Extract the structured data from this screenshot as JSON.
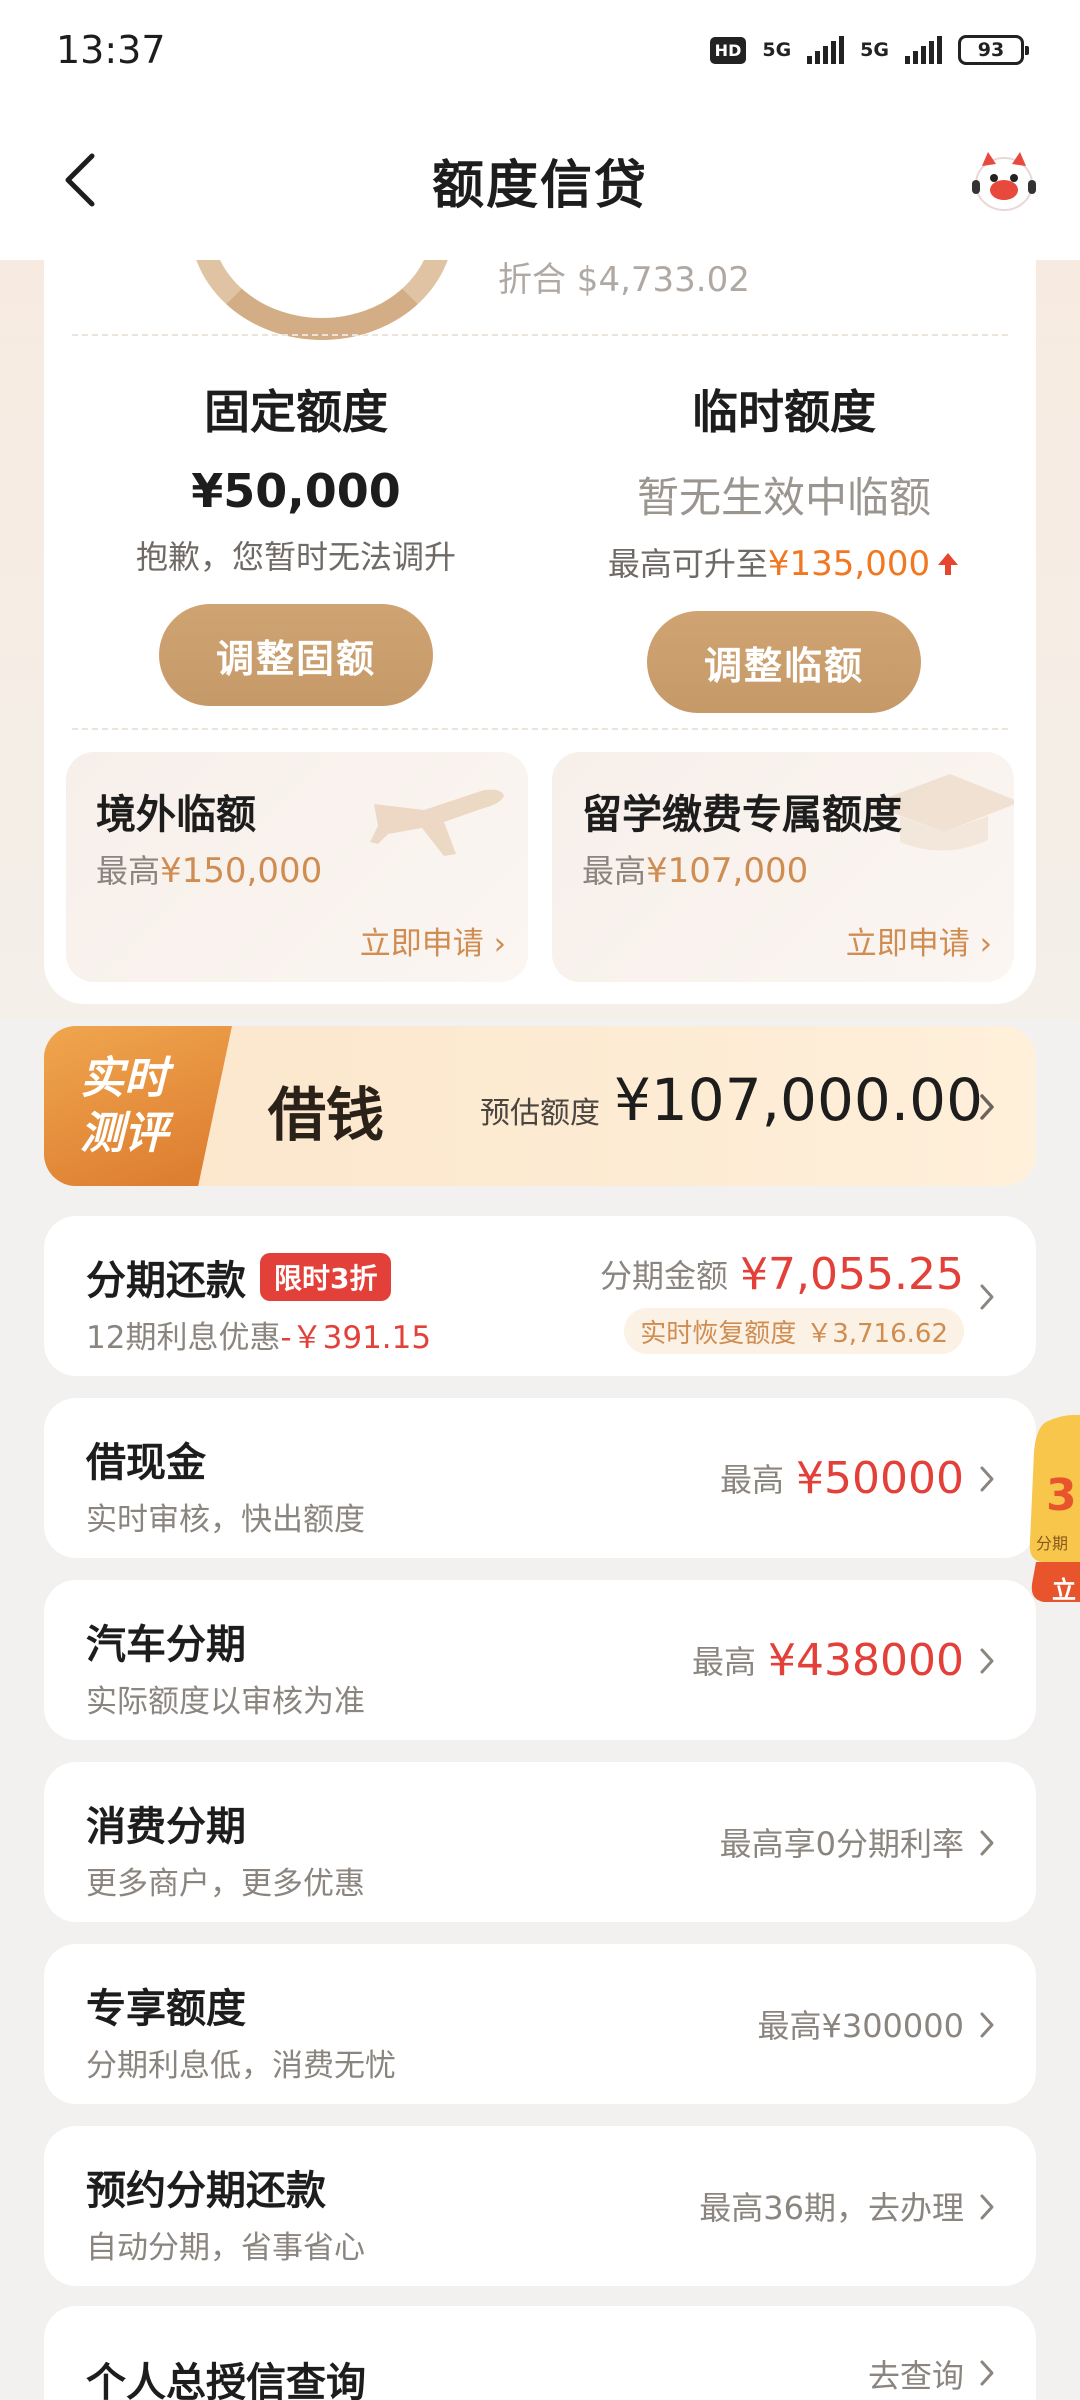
{
  "status": {
    "time": "13:37",
    "network1": "5G",
    "network2": "5G",
    "hd": "HD",
    "battery": "93"
  },
  "nav": {
    "title": "额度信贷"
  },
  "summary": {
    "converted": "折合 $4,733.02"
  },
  "fixed_limit": {
    "title": "固定额度",
    "amount": "¥50,000",
    "note": "抱歉，您暂时无法调升",
    "button": "调整固额"
  },
  "temp_limit": {
    "title": "临时额度",
    "status": "暂无生效中临额",
    "note_prefix": "最高可升至",
    "note_amount": "¥135,000",
    "button": "调整临额"
  },
  "promos": [
    {
      "title": "境外临额",
      "prefix": "最高",
      "amount": "¥150,000",
      "link": "立即申请"
    },
    {
      "title": "留学缴费专属额度",
      "prefix": "最高",
      "amount": "¥107,000",
      "link": "立即申请"
    }
  ],
  "borrow": {
    "tag_line1": "实时",
    "tag_line2": "测评",
    "title": "借钱",
    "est_label": "预估额度",
    "est_amount": "¥107,000.00"
  },
  "installment": {
    "title": "分期还款",
    "tag": "限时3折",
    "sub_prefix": "12期利息优惠",
    "sub_amount": "-￥391.15",
    "amount_label": "分期金额",
    "amount": "¥7,055.25",
    "recover_label": "实时恢复额度",
    "recover_amount": "￥3,716.62"
  },
  "list": [
    {
      "title": "借现金",
      "sub": "实时审核，快出额度",
      "right_label": "最高",
      "right_value": "¥50000"
    },
    {
      "title": "汽车分期",
      "sub": "实际额度以审核为准",
      "right_label": "最高",
      "right_value": "¥438000"
    },
    {
      "title": "消费分期",
      "sub": "更多商户，更多优惠",
      "right_label": "最高享0分期利率",
      "right_value": ""
    },
    {
      "title": "专享额度",
      "sub": "分期利息低，消费无忧",
      "right_label": "最高¥300000",
      "right_value": ""
    },
    {
      "title": "预约分期还款",
      "sub": "自动分期，省事省心",
      "right_label": "最高36期，去办理",
      "right_value": ""
    },
    {
      "title": "个人总授信查询",
      "sub": "",
      "right_label": "去查询",
      "right_value": ""
    }
  ],
  "float_badge": {
    "big": "3",
    "small": "分期",
    "cta": "立"
  },
  "colors": {
    "gold": "#c59968",
    "accent_orange": "#f27722",
    "red": "#e3403a"
  }
}
